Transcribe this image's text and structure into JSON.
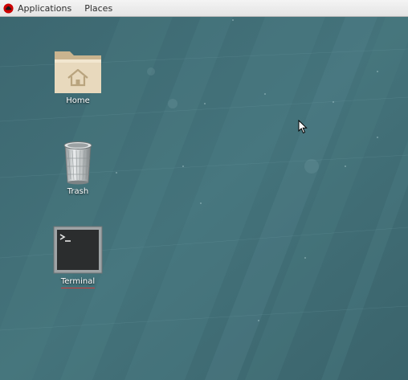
{
  "topbar": {
    "applications_label": "Applications",
    "places_label": "Places",
    "icons": {
      "logo": "redhat-logo-icon"
    }
  },
  "desktop": {
    "icons": [
      {
        "label": "Home",
        "icon": "home-folder-icon"
      },
      {
        "label": "Trash",
        "icon": "trash-icon"
      },
      {
        "label": "Terminal",
        "icon": "terminal-icon"
      }
    ]
  },
  "colors": {
    "desktop_background": "#3f6c74",
    "topbar_background": "#ececec",
    "label_text": "#ffffff",
    "focus_underline": "#d23a3a",
    "redhat_red": "#cc0000"
  }
}
